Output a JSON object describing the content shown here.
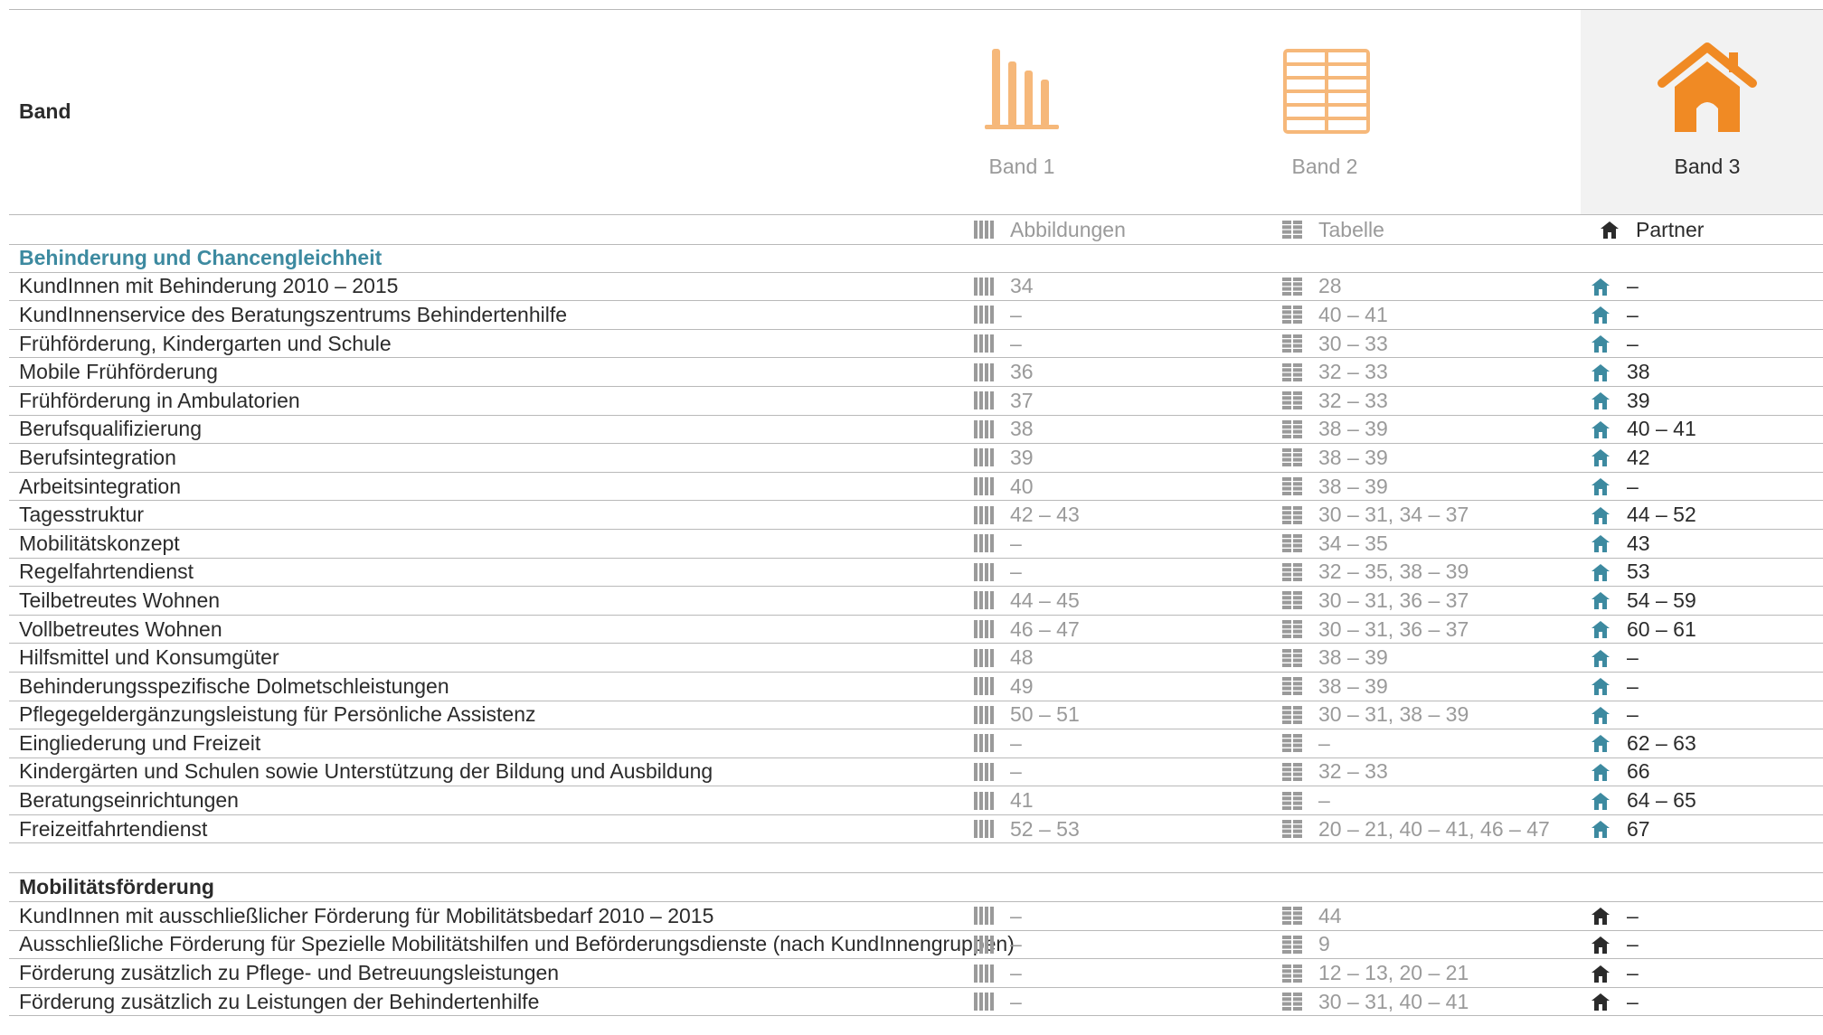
{
  "header": {
    "band_label": "Band",
    "bands": [
      {
        "caption": "Band 1",
        "icon": "bar-chart-icon"
      },
      {
        "caption": "Band 2",
        "icon": "table-grid-icon"
      },
      {
        "caption": "Band 3",
        "icon": "house-icon"
      }
    ]
  },
  "legend": {
    "abbildungen": "Abbildungen",
    "tabelle": "Tabelle",
    "partner": "Partner"
  },
  "colors": {
    "accent_teal": "#3d8aa0",
    "accent_orange": "#f08a24",
    "light_orange": "#f6b87a",
    "rule_gray": "#b9b9b9",
    "muted_gray": "#9a9a9a"
  },
  "sections": [
    {
      "title": "Behinderung und Chancengleichheit",
      "rows": [
        {
          "name": "KundInnen mit Behinderung 2010 – 2015",
          "abb": "34",
          "tab": "28",
          "par": "–"
        },
        {
          "name": "KundInnenservice des Beratungszentrums Behindertenhilfe",
          "abb": "–",
          "tab": "40 – 41",
          "par": "–"
        },
        {
          "name": "Frühförderung, Kindergarten und Schule",
          "abb": "–",
          "tab": "30 – 33",
          "par": "–"
        },
        {
          "name": "Mobile Frühförderung",
          "abb": "36",
          "tab": "32 – 33",
          "par": "38"
        },
        {
          "name": "Frühförderung in Ambulatorien",
          "abb": "37",
          "tab": "32 – 33",
          "par": "39"
        },
        {
          "name": "Berufsqualifizierung",
          "abb": "38",
          "tab": "38 – 39",
          "par": "40 – 41"
        },
        {
          "name": "Berufsintegration",
          "abb": "39",
          "tab": "38 – 39",
          "par": "42"
        },
        {
          "name": "Arbeitsintegration",
          "abb": "40",
          "tab": "38 – 39",
          "par": "–"
        },
        {
          "name": "Tagesstruktur",
          "abb": "42 – 43",
          "tab": "30 – 31, 34 – 37",
          "par": "44 – 52"
        },
        {
          "name": "Mobilitätskonzept",
          "abb": "–",
          "tab": "34 – 35",
          "par": "43"
        },
        {
          "name": "Regelfahrtendienst",
          "abb": "–",
          "tab": "32 – 35, 38 – 39",
          "par": "53"
        },
        {
          "name": "Teilbetreutes Wohnen",
          "abb": "44 – 45",
          "tab": "30 – 31, 36 – 37",
          "par": "54 – 59"
        },
        {
          "name": "Vollbetreutes Wohnen",
          "abb": "46 – 47",
          "tab": "30 – 31, 36 – 37",
          "par": "60 – 61"
        },
        {
          "name": "Hilfsmittel und Konsumgüter",
          "abb": "48",
          "tab": "38 – 39",
          "par": "–"
        },
        {
          "name": "Behinderungsspezifische Dolmetschleistungen",
          "abb": "49",
          "tab": "38 – 39",
          "par": "–"
        },
        {
          "name": "Pflegegeldergänzungsleistung für Persönliche Assistenz",
          "abb": "50 – 51",
          "tab": "30 – 31, 38 – 39",
          "par": "–"
        },
        {
          "name": "Eingliederung und Freizeit",
          "abb": "–",
          "tab": "–",
          "par": "62 – 63"
        },
        {
          "name": "Kindergärten und Schulen sowie Unterstützung der Bildung und Ausbildung",
          "abb": "–",
          "tab": "32 – 33",
          "par": "66"
        },
        {
          "name": "Beratungseinrichtungen",
          "abb": "41",
          "tab": "–",
          "par": "64 – 65"
        },
        {
          "name": "Freizeitfahrtendienst",
          "abb": "52 – 53",
          "tab": "20 – 21, 40 – 41, 46 – 47",
          "par": "67"
        }
      ]
    },
    {
      "title": "Mobilitätsförderung",
      "rows": [
        {
          "name": "KundInnen mit ausschließlicher Förderung für Mobilitätsbedarf 2010 – 2015",
          "abb": "–",
          "tab": "44",
          "par": "–"
        },
        {
          "name": "Ausschließliche Förderung für Spezielle Mobilitätshilfen und Beförderungsdienste (nach KundInnengruppen)",
          "abb": "–",
          "tab": "9",
          "par": "–"
        },
        {
          "name": "Förderung zusätzlich zu Pflege- und Betreuungsleistungen",
          "abb": "–",
          "tab": "12 – 13, 20 – 21",
          "par": "–"
        },
        {
          "name": "Förderung zusätzlich zu Leistungen der Behindertenhilfe",
          "abb": "–",
          "tab": "30 – 31, 40 – 41",
          "par": "–"
        }
      ]
    }
  ]
}
